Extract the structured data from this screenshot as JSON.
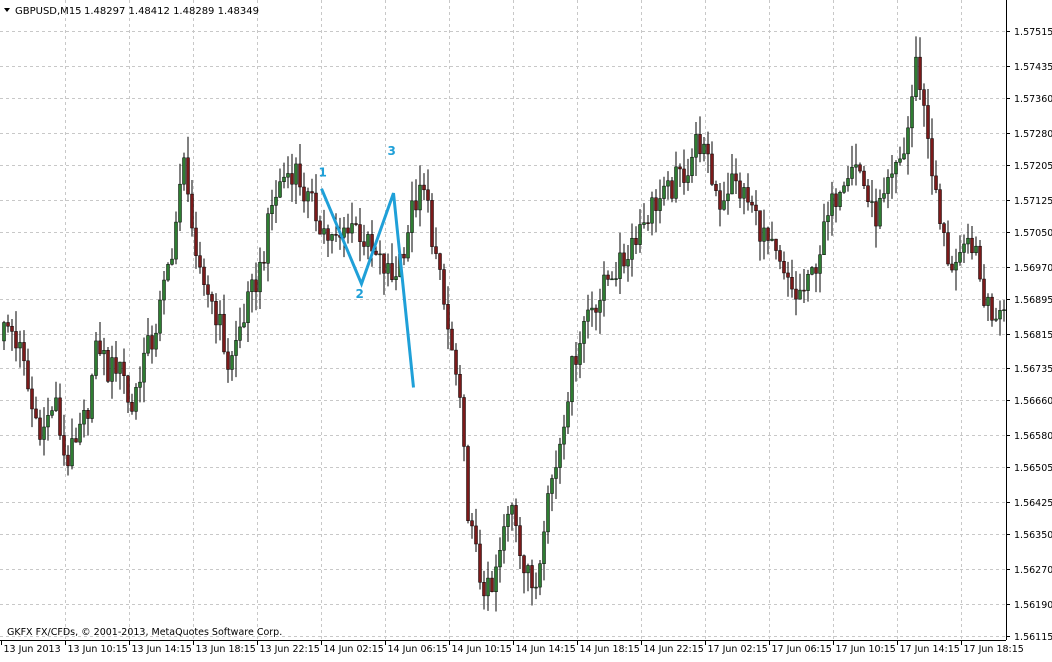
{
  "header": {
    "symbol_label": "GBPUSD,M15",
    "ohlc_label": "1.48297 1.48412 1.48289 1.48349",
    "triangle_icon": "small-down-triangle-icon"
  },
  "footer": {
    "copyright": "GKFX FX/CFDs, © 2001-2013, MetaQuotes Software Corp."
  },
  "annotations": {
    "labels": [
      "1",
      "2",
      "3"
    ],
    "color": "#1fa0d8",
    "zigzag_points": [
      {
        "t": "14 Jun 02:15",
        "price": 1.5715
      },
      {
        "t": "14 Jun 04:45",
        "price": 1.5693
      },
      {
        "t": "14 Jun 06:45",
        "price": 1.5714
      },
      {
        "t": "14 Jun 08:00",
        "price": 1.5669
      }
    ]
  },
  "chart_data": {
    "type": "candlestick",
    "symbol": "GBPUSD",
    "timeframe": "M15",
    "ylim": [
      1.5611,
      1.5756
    ],
    "yticks": [
      "1.57515",
      "1.57435",
      "1.57360",
      "1.57280",
      "1.57205",
      "1.57125",
      "1.57050",
      "1.56970",
      "1.56895",
      "1.56815",
      "1.56735",
      "1.56660",
      "1.56580",
      "1.56505",
      "1.56425",
      "1.56350",
      "1.56270",
      "1.56190",
      "1.56115"
    ],
    "xticks": [
      "13 Jun 2013",
      "13 Jun 10:15",
      "13 Jun 14:15",
      "13 Jun 18:15",
      "13 Jun 22:15",
      "14 Jun 02:15",
      "14 Jun 06:15",
      "14 Jun 10:15",
      "14 Jun 14:15",
      "14 Jun 18:15",
      "14 Jun 22:15",
      "17 Jun 02:15",
      "17 Jun 06:15",
      "17 Jun 10:15",
      "17 Jun 14:15",
      "17 Jun 18:15"
    ],
    "grid": true,
    "colors": {
      "bull": "#2e7d32",
      "bear": "#7b1a1a",
      "wick": "#000000",
      "grid": "#c8c8c8"
    },
    "close_path": [
      1.5682,
      1.5683,
      1.5676,
      1.5663,
      1.5659,
      1.5666,
      1.5652,
      1.5655,
      1.5664,
      1.568,
      1.5672,
      1.5676,
      1.5663,
      1.5675,
      1.568,
      1.5691,
      1.5705,
      1.5723,
      1.5695,
      1.5692,
      1.5685,
      1.5673,
      1.5683,
      1.569,
      1.5698,
      1.5712,
      1.5718,
      1.572,
      1.5713,
      1.5709,
      1.5704,
      1.5702,
      1.5708,
      1.5705,
      1.57,
      1.5697,
      1.5694,
      1.5702,
      1.5712,
      1.5714,
      1.5698,
      1.5683,
      1.5668,
      1.5638,
      1.5625,
      1.562,
      1.5633,
      1.5644,
      1.5627,
      1.5622,
      1.5642,
      1.5652,
      1.5668,
      1.568,
      1.5688,
      1.569,
      1.5696,
      1.5697,
      1.5704,
      1.5708,
      1.5712,
      1.5713,
      1.5717,
      1.572,
      1.5727,
      1.5719,
      1.5712,
      1.5717,
      1.5714,
      1.571,
      1.5704,
      1.5699,
      1.5693,
      1.569,
      1.5692,
      1.57,
      1.5709,
      1.5717,
      1.5722,
      1.5718,
      1.5708,
      1.5712,
      1.5718,
      1.5725,
      1.5745,
      1.5728,
      1.5708,
      1.5698,
      1.5697,
      1.5704,
      1.5691,
      1.5686,
      1.569
    ]
  }
}
